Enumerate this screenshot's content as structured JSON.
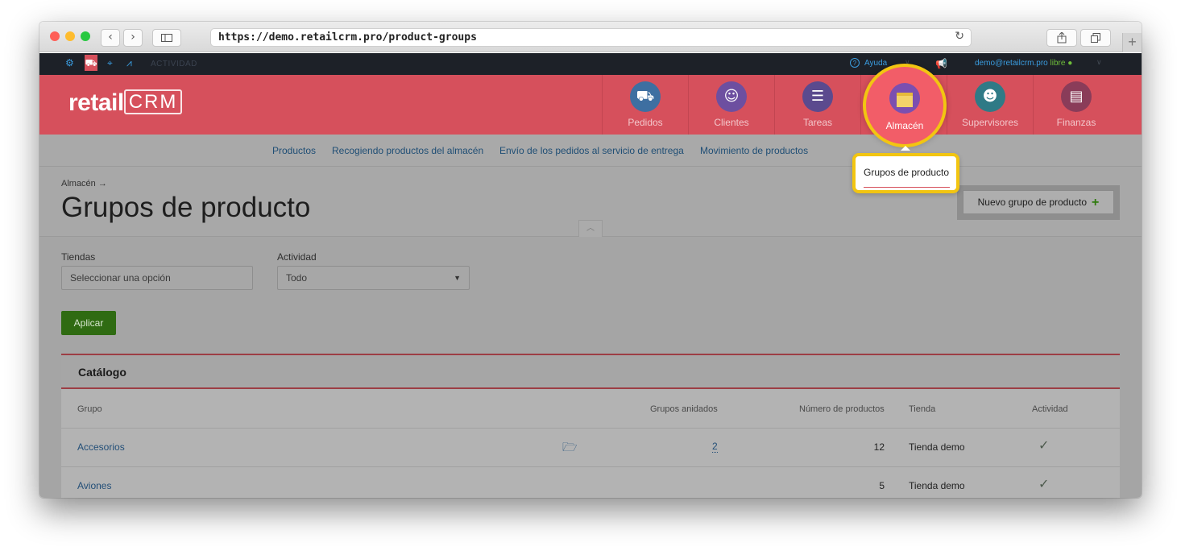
{
  "browser": {
    "url": "https://demo.retailcrm.pro/product-groups",
    "back_icon": "chevron-left",
    "forward_icon": "chevron-right",
    "sidebar_icon": "sidebar",
    "reload_icon": "reload",
    "share_icon": "share",
    "tabs_icon": "tabs",
    "new_tab_icon": "plus",
    "light_colors": [
      "#fe5f57",
      "#febc2e",
      "#28c840"
    ]
  },
  "topbar": {
    "activity_label": "ACTIVIDAD",
    "help_label": "Ayuda",
    "user_email": "demo@retailcrm.pro",
    "status_label": "libre"
  },
  "header": {
    "logo": {
      "retail": "retail",
      "crm": "CRM"
    },
    "nav": [
      {
        "label": "Pedidos",
        "icon": "cart-icon",
        "color": "#3e6fa1"
      },
      {
        "label": "Clientes",
        "icon": "user-icon",
        "color": "#6d4fa0"
      },
      {
        "label": "Tareas",
        "icon": "chat-icon",
        "color": "#5b4a8e"
      },
      {
        "label": "Almacén",
        "icon": "box-icon",
        "color": "#7b4fb0"
      },
      {
        "label": "Supervisores",
        "icon": "manager-icon",
        "color": "#2f7a86"
      },
      {
        "label": "Finanzas",
        "icon": "ledger-icon",
        "color": "#8a3c59"
      }
    ]
  },
  "subnav": {
    "links": [
      "Productos",
      "Recogiendo productos del almacén",
      "Envío de los pedidos al servicio de entrega",
      "Movimiento de productos"
    ],
    "active": "Grupos de producto"
  },
  "page": {
    "breadcrumb": "Almacén →",
    "title": "Grupos de producto",
    "new_button": "Nuevo grupo de producto",
    "new_button_plus": "+"
  },
  "filters": {
    "stores_label": "Tiendas",
    "stores_placeholder": "Seleccionar una opción",
    "activity_label": "Actividad",
    "activity_value": "Todo",
    "apply_label": "Aplicar"
  },
  "catalog": {
    "title": "Catálogo",
    "columns": {
      "group": "Grupo",
      "nested": "Grupos anidados",
      "count": "Número de productos",
      "store": "Tienda",
      "activity": "Actividad"
    },
    "rows": [
      {
        "group": "Accesorios",
        "nested": "2",
        "count": "12",
        "store": "Tienda demo",
        "active": true,
        "has_folder": true
      },
      {
        "group": "Aviones",
        "nested": "",
        "count": "5",
        "store": "Tienda demo",
        "active": true,
        "has_folder": false
      }
    ]
  }
}
